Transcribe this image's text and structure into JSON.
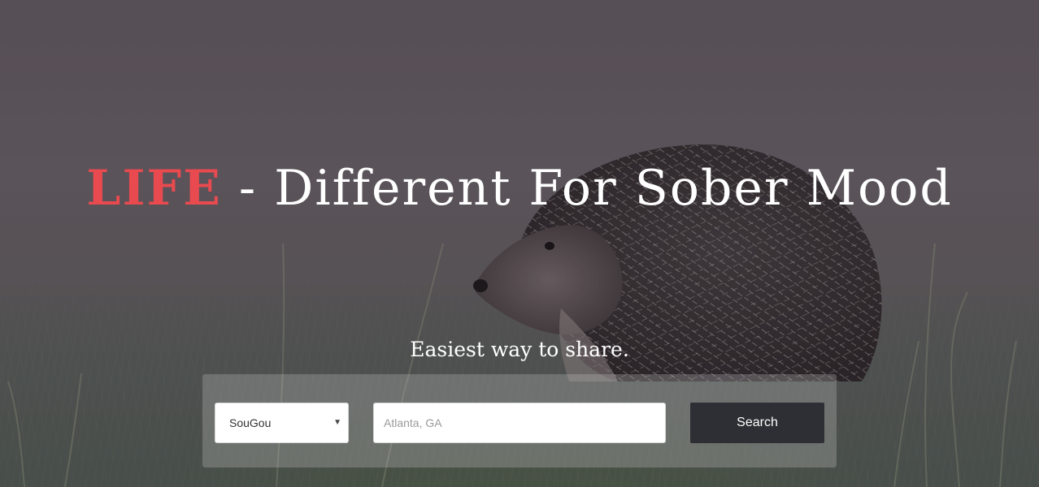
{
  "hero": {
    "headline_accent": "LIFE",
    "headline_rest": " - Different For Sober Mood",
    "tagline": "Easiest way to share."
  },
  "search": {
    "select_value": "SouGou",
    "input_placeholder": "Atlanta, GA",
    "button_label": "Search"
  },
  "colors": {
    "accent": "#e84a4f",
    "button_bg": "#2e2f34"
  },
  "background": {
    "subject": "hedgehog-in-grass-photo"
  }
}
